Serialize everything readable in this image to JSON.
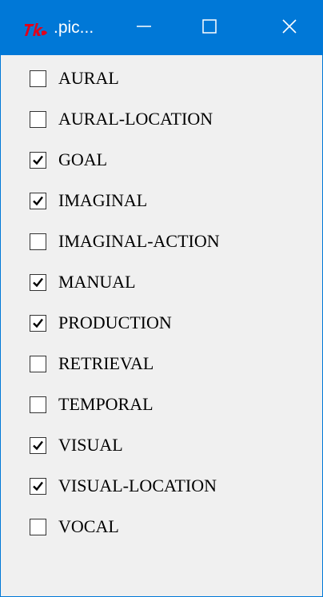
{
  "window": {
    "title": ".pic...",
    "app_icon": "tk-feather-icon",
    "accent_color": "#0078d7",
    "icons": {
      "minimize": "minimize-icon",
      "maximize": "maximize-icon",
      "close": "close-icon"
    }
  },
  "checkboxes": [
    {
      "label": "AURAL",
      "checked": false
    },
    {
      "label": "AURAL-LOCATION",
      "checked": false
    },
    {
      "label": "GOAL",
      "checked": true
    },
    {
      "label": "IMAGINAL",
      "checked": true
    },
    {
      "label": "IMAGINAL-ACTION",
      "checked": false
    },
    {
      "label": "MANUAL",
      "checked": true
    },
    {
      "label": "PRODUCTION",
      "checked": true
    },
    {
      "label": "RETRIEVAL",
      "checked": false
    },
    {
      "label": "TEMPORAL",
      "checked": false
    },
    {
      "label": "VISUAL",
      "checked": true
    },
    {
      "label": "VISUAL-LOCATION",
      "checked": true
    },
    {
      "label": "VOCAL",
      "checked": false
    }
  ]
}
